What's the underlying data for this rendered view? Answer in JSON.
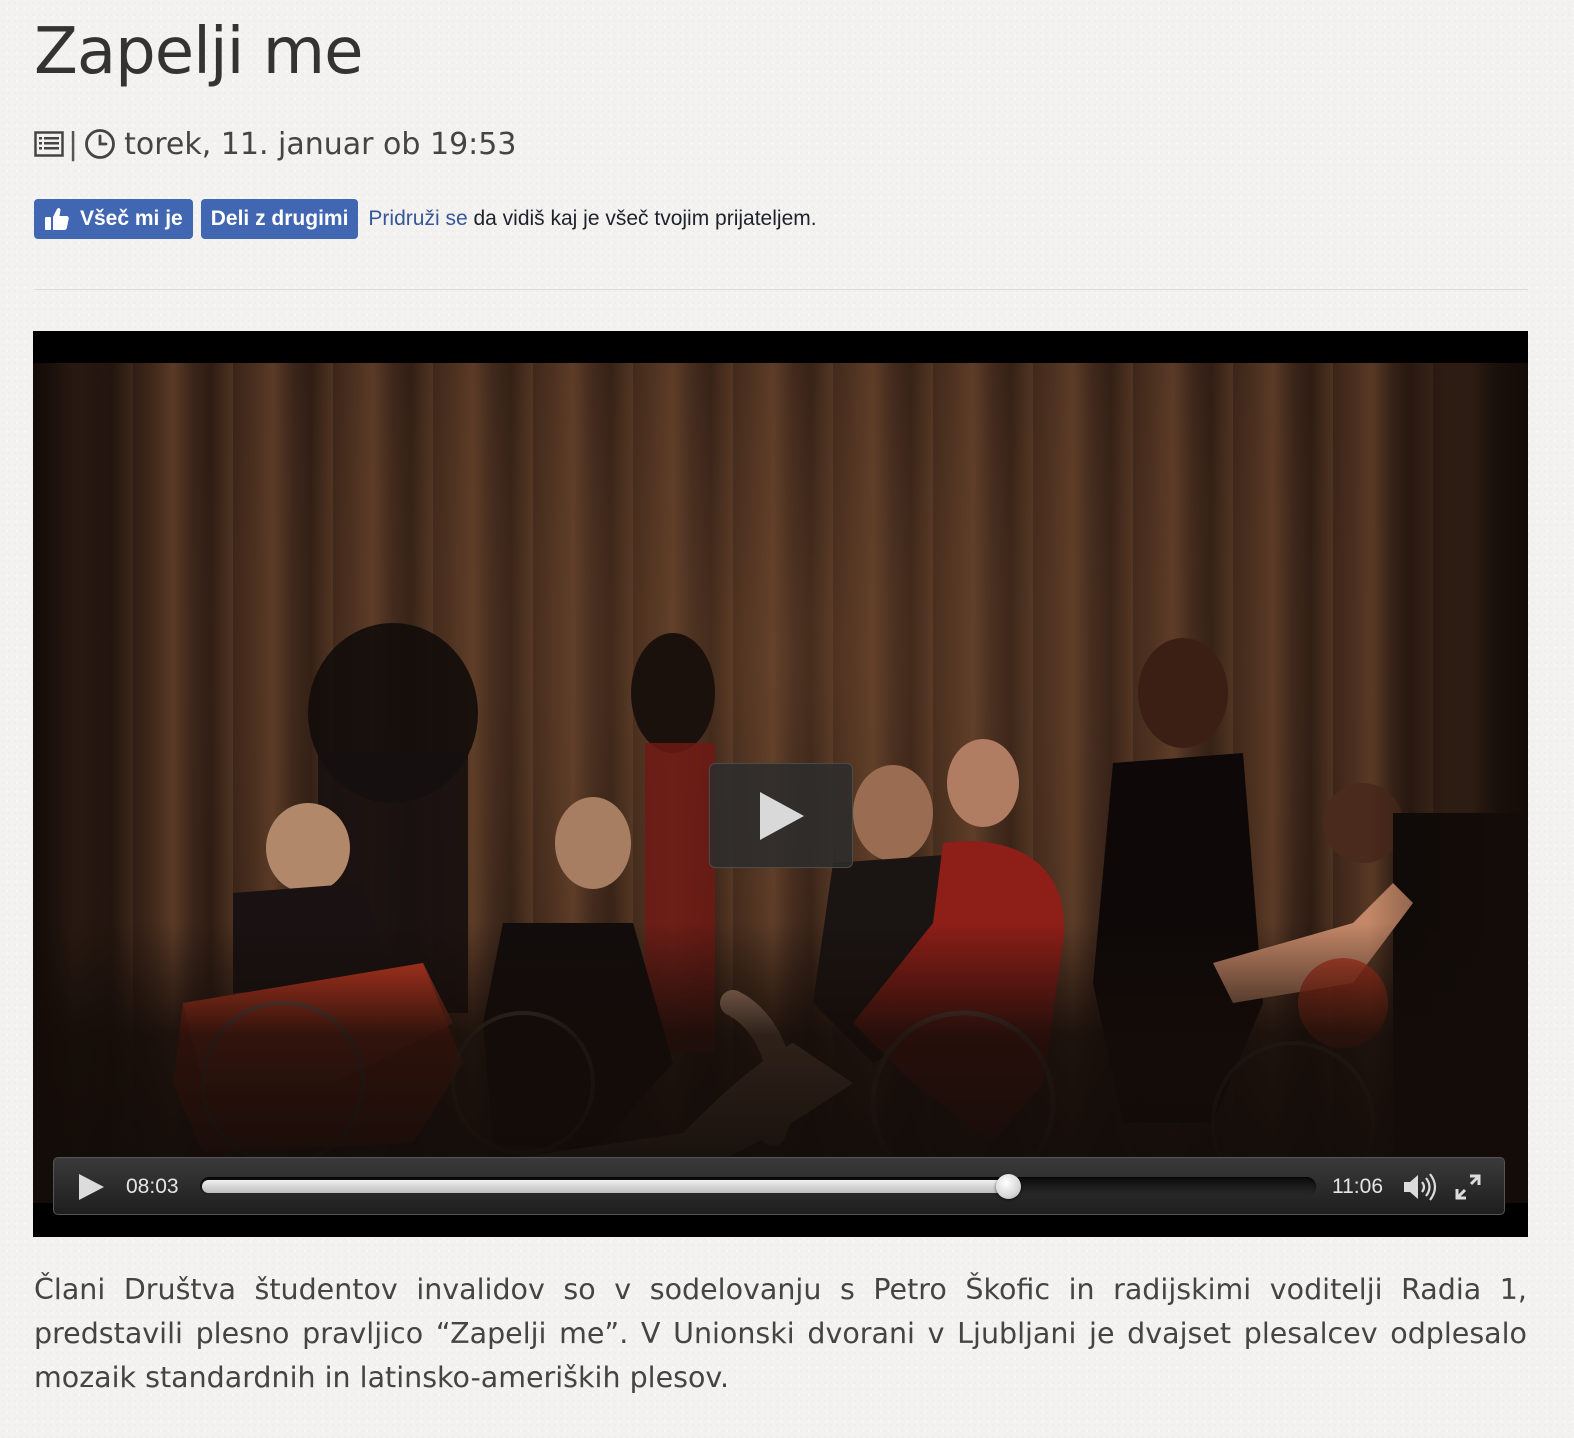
{
  "article": {
    "title": "Zapelji me",
    "meta": {
      "separator": "|",
      "date": "torek, 11. januar ob 19:53",
      "category_icon": "list-icon",
      "time_icon": "clock-icon"
    },
    "description": "Člani Društva študentov invalidov so v sodelovanju s Petro Škofic in radijskimi voditelji Radia 1, predstavili plesno pravljico “Zapelji me”. V Unionski dvorani v Ljubljani je dvajset plesalcev odplesalo mozaik standardnih in latinsko-ameriških plesov."
  },
  "facebook": {
    "like_label": "Všeč mi je",
    "share_label": "Deli z drugimi",
    "join_link": "Pridruži se",
    "join_text": " da vidiš kaj je všeč tvojim prijateljem.",
    "brand_color": "#4267b2"
  },
  "player": {
    "current_time": "08:03",
    "total_time": "11:06",
    "progress": 0.725,
    "icons": {
      "big_play": "play-icon",
      "play": "play-icon",
      "volume": "volume-icon",
      "fullscreen": "fullscreen-icon"
    }
  }
}
